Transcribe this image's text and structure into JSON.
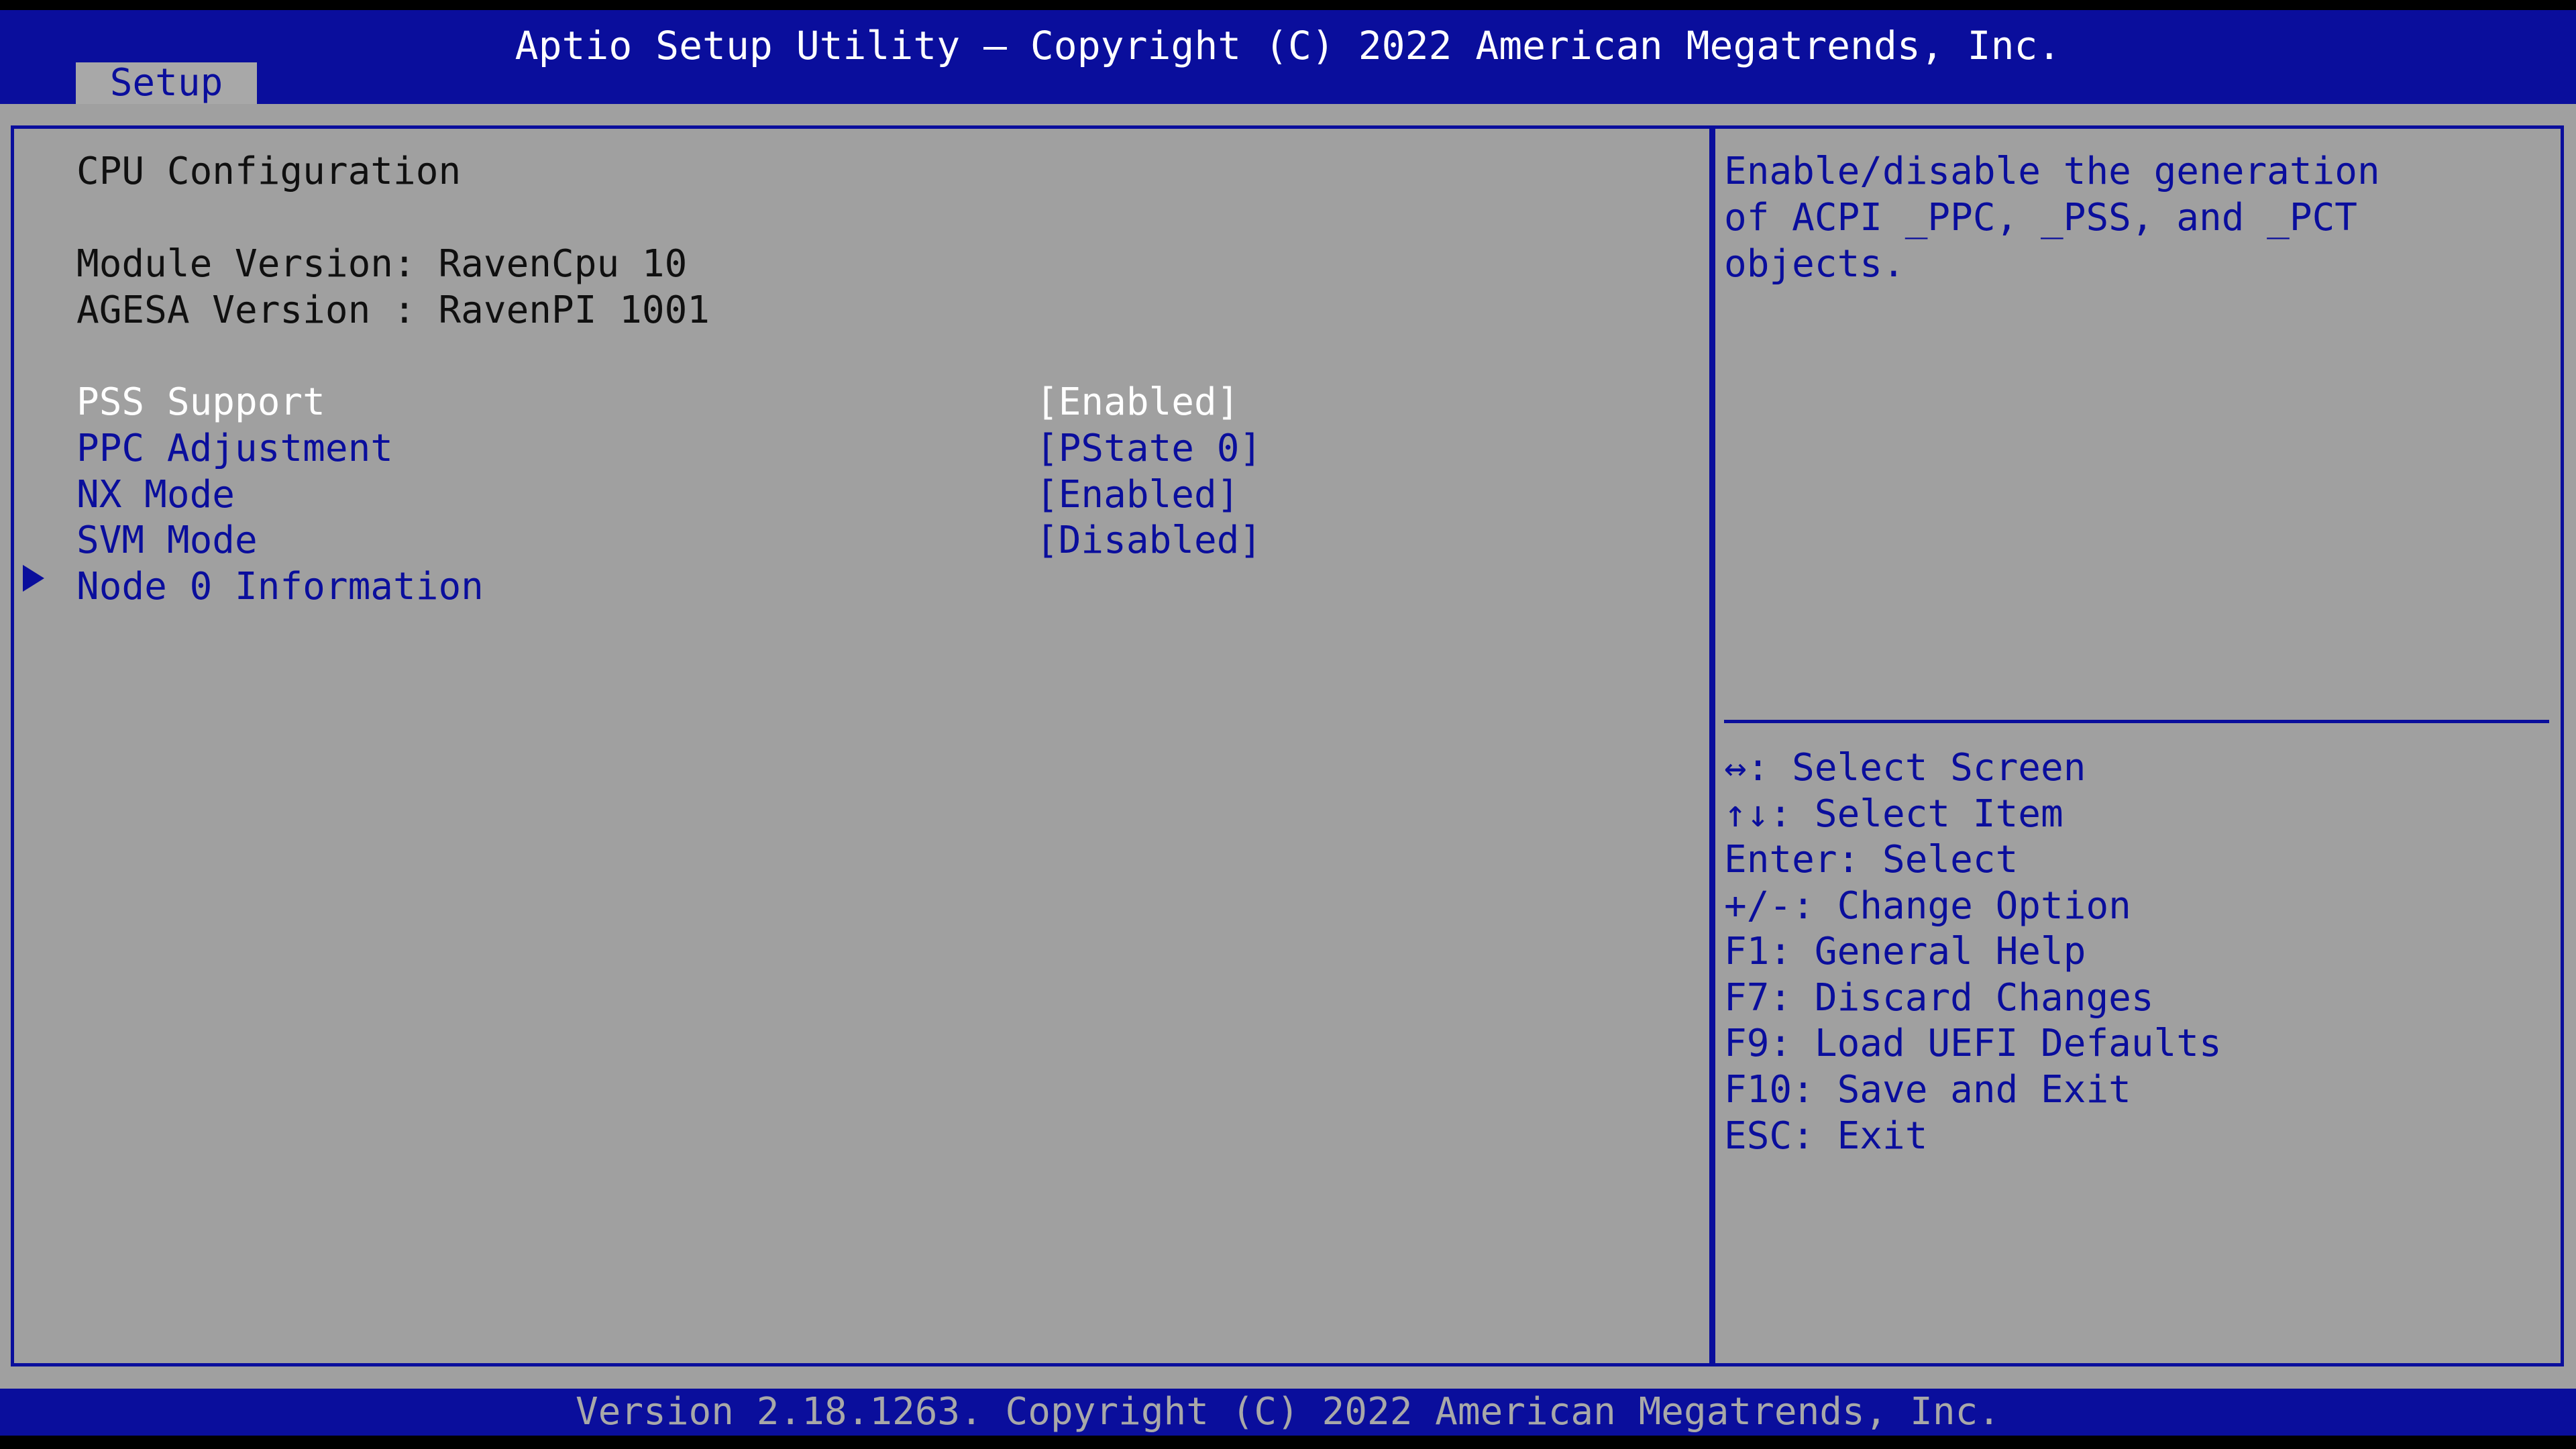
{
  "header": {
    "title": "Aptio Setup Utility – Copyright (C) 2022 American Megatrends, Inc.",
    "tab_setup": "Setup"
  },
  "main": {
    "section_title": "CPU Configuration",
    "module_version": "Module Version: RavenCpu 10",
    "agesa_version": "AGESA Version : RavenPI 1001",
    "items": [
      {
        "label": "PSS Support",
        "value": "[Enabled]"
      },
      {
        "label": "PPC Adjustment",
        "value": "[PState 0]"
      },
      {
        "label": "NX Mode",
        "value": "[Enabled]"
      },
      {
        "label": "SVM Mode",
        "value": "[Disabled]"
      },
      {
        "label": "Node 0 Information",
        "value": ""
      }
    ]
  },
  "help": {
    "description_lines": [
      "Enable/disable the generation",
      "of ACPI _PPC, _PSS, and _PCT",
      "objects."
    ],
    "keys": [
      "↔: Select Screen",
      "↑↓: Select Item",
      "Enter: Select",
      "+/-: Change Option",
      "F1: General Help",
      "F7: Discard Changes",
      "F9: Load UEFI Defaults",
      "F10: Save and Exit",
      "ESC: Exit"
    ]
  },
  "footer": {
    "version": "Version 2.18.1263. Copyright (C) 2022 American Megatrends, Inc."
  },
  "colors": {
    "bios_blue": "#0a0e9c",
    "panel_gray": "#a0a0a0",
    "text_white": "#ffffff",
    "text_dark": "#101010"
  }
}
